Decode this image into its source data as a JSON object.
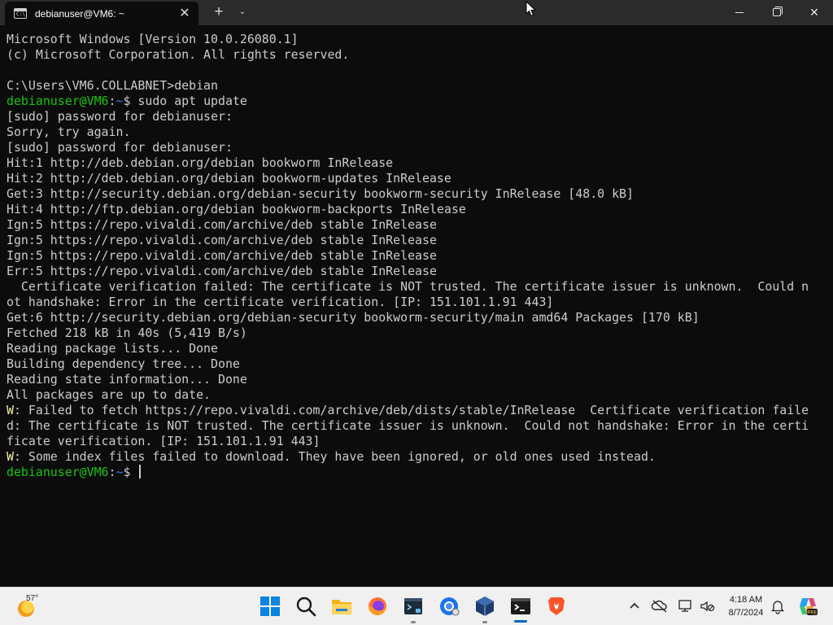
{
  "window": {
    "tab_title": "debianuser@VM6: ~",
    "tab_icon_text": "C:\\",
    "new_tab_glyph": "+",
    "dropdown_glyph": "⌄",
    "close_glyph": "✕"
  },
  "terminal": {
    "lines": [
      {
        "segments": [
          {
            "text": "Microsoft Windows [Version 10.0.26080.1]"
          }
        ]
      },
      {
        "segments": [
          {
            "text": "(c) Microsoft Corporation. All rights reserved."
          }
        ]
      },
      {
        "segments": [
          {
            "text": ""
          }
        ]
      },
      {
        "segments": [
          {
            "text": "C:\\Users\\VM6.COLLABNET>debian"
          }
        ]
      },
      {
        "segments": [
          {
            "text": "debianuser@VM6",
            "style": "prompt-user"
          },
          {
            "text": ":"
          },
          {
            "text": "~",
            "style": "prompt-path"
          },
          {
            "text": "$ sudo apt update"
          }
        ]
      },
      {
        "segments": [
          {
            "text": "[sudo] password for debianuser:"
          }
        ]
      },
      {
        "segments": [
          {
            "text": "Sorry, try again."
          }
        ]
      },
      {
        "segments": [
          {
            "text": "[sudo] password for debianuser:"
          }
        ]
      },
      {
        "segments": [
          {
            "text": "Hit:1 http://deb.debian.org/debian bookworm InRelease"
          }
        ]
      },
      {
        "segments": [
          {
            "text": "Hit:2 http://deb.debian.org/debian bookworm-updates InRelease"
          }
        ]
      },
      {
        "segments": [
          {
            "text": "Get:3 http://security.debian.org/debian-security bookworm-security InRelease [48.0 kB]"
          }
        ]
      },
      {
        "segments": [
          {
            "text": "Hit:4 http://ftp.debian.org/debian bookworm-backports InRelease"
          }
        ]
      },
      {
        "segments": [
          {
            "text": "Ign:5 https://repo.vivaldi.com/archive/deb stable InRelease"
          }
        ]
      },
      {
        "segments": [
          {
            "text": "Ign:5 https://repo.vivaldi.com/archive/deb stable InRelease"
          }
        ]
      },
      {
        "segments": [
          {
            "text": "Ign:5 https://repo.vivaldi.com/archive/deb stable InRelease"
          }
        ]
      },
      {
        "segments": [
          {
            "text": "Err:5 https://repo.vivaldi.com/archive/deb stable InRelease"
          }
        ]
      },
      {
        "segments": [
          {
            "text": "  Certificate verification failed: The certificate is NOT trusted. The certificate issuer is unknown.  Could n"
          }
        ]
      },
      {
        "segments": [
          {
            "text": "ot handshake: Error in the certificate verification. [IP: 151.101.1.91 443]"
          }
        ]
      },
      {
        "segments": [
          {
            "text": "Get:6 http://security.debian.org/debian-security bookworm-security/main amd64 Packages [170 kB]"
          }
        ]
      },
      {
        "segments": [
          {
            "text": "Fetched 218 kB in 40s (5,419 B/s)"
          }
        ]
      },
      {
        "segments": [
          {
            "text": "Reading package lists... Done"
          }
        ]
      },
      {
        "segments": [
          {
            "text": "Building dependency tree... Done"
          }
        ]
      },
      {
        "segments": [
          {
            "text": "Reading state information... Done"
          }
        ]
      },
      {
        "segments": [
          {
            "text": "All packages are up to date."
          }
        ]
      },
      {
        "segments": [
          {
            "text": "W",
            "style": "warn"
          },
          {
            "text": ": Failed to fetch https://repo.vivaldi.com/archive/deb/dists/stable/InRelease  Certificate verification faile"
          }
        ]
      },
      {
        "segments": [
          {
            "text": "d: The certificate is NOT trusted. The certificate issuer is unknown.  Could not handshake: Error in the certi"
          }
        ]
      },
      {
        "segments": [
          {
            "text": "ficate verification. [IP: 151.101.1.91 443]"
          }
        ]
      },
      {
        "segments": [
          {
            "text": "W",
            "style": "warn"
          },
          {
            "text": ": Some index files failed to download. They have been ignored, or old ones used instead."
          }
        ]
      },
      {
        "segments": [
          {
            "text": "debianuser@VM6",
            "style": "prompt-user"
          },
          {
            "text": ":"
          },
          {
            "text": "~",
            "style": "prompt-path"
          },
          {
            "text": "$ "
          }
        ],
        "cursor": true
      }
    ]
  },
  "taskbar": {
    "weather_temp": "57°",
    "clock_time": "4:18 AM",
    "clock_date": "8/7/2024",
    "tray_chevron": "^",
    "icons": [
      "start-icon",
      "search-icon",
      "file-explorer-icon",
      "firefox-icon",
      "terminal-app-icon",
      "chrome-icon",
      "virtualbox-icon",
      "windows-terminal-icon",
      "brave-icon"
    ]
  },
  "colors": {
    "terminal_bg": "#0c0c0c",
    "terminal_text": "#cccccc",
    "prompt_user": "#16c60c",
    "prompt_path": "#3b78ff",
    "warning": "#f9f1a5",
    "taskbar_bg": "#f0f0f0",
    "accent": "#0067c0"
  }
}
